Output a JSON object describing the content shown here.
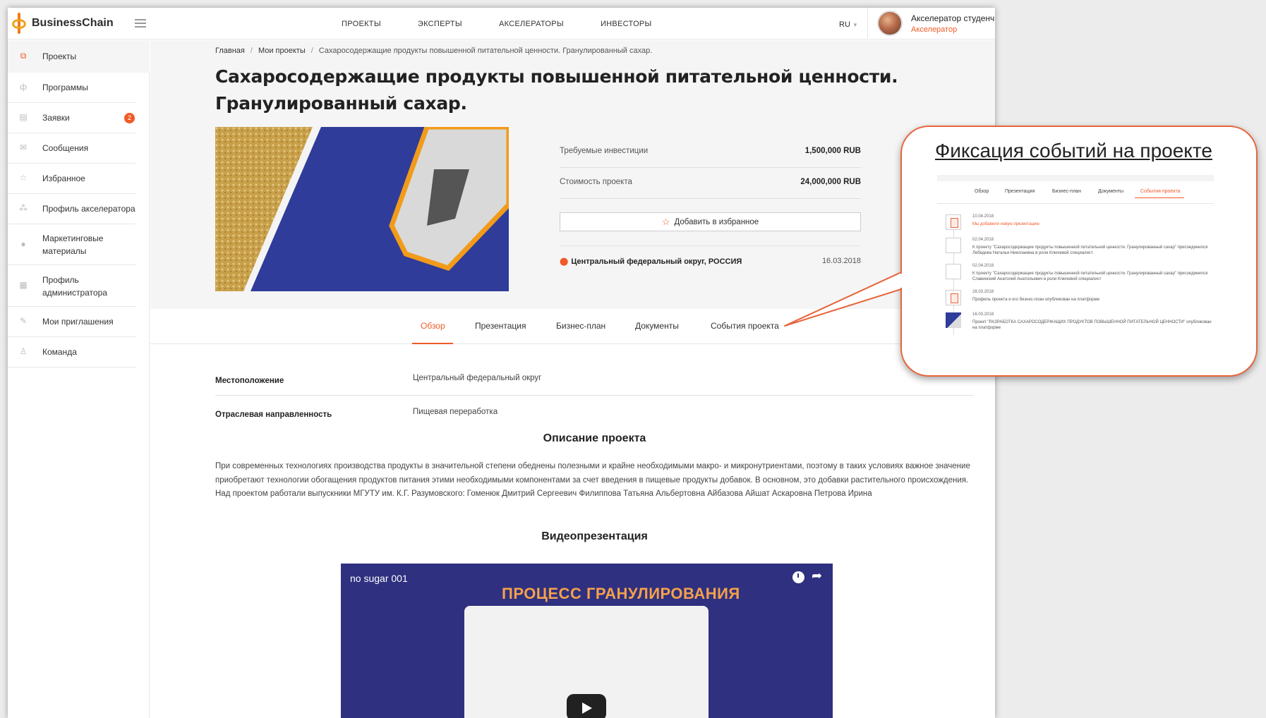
{
  "header": {
    "brand": "BusinessChain",
    "nav": [
      "ПРОЕКТЫ",
      "ЭКСПЕРТЫ",
      "АКСЕЛЕРАТОРЫ",
      "ИНВЕСТОРЫ"
    ],
    "language": "RU",
    "user_name": "Акселератор студенч",
    "user_role": "Акселератор"
  },
  "sidebar": {
    "items": [
      {
        "label": "Проекты",
        "icon": "projects-icon"
      },
      {
        "label": "Программы",
        "icon": "programs-icon"
      },
      {
        "label": "Заявки",
        "icon": "applications-icon",
        "badge": "2"
      },
      {
        "label": "Сообщения",
        "icon": "mail-icon"
      },
      {
        "label": "Избранное",
        "icon": "star-icon"
      },
      {
        "label": "Профиль акселератора",
        "icon": "org-icon"
      },
      {
        "label": "Маркетинговые материалы",
        "icon": "globe-icon"
      },
      {
        "label": "Профиль администратора",
        "icon": "grid-icon"
      },
      {
        "label": "Мои приглашения",
        "icon": "edit-icon"
      },
      {
        "label": "Команда",
        "icon": "user-icon"
      }
    ]
  },
  "breadcrumb": [
    "Главная",
    "Мои проекты",
    "Сахаросодержащие продукты повышенной питательной ценности. Гранулированный сахар."
  ],
  "project": {
    "title": "Сахаросодержащие продукты повышенной питательной ценности. Гранулированный сахар.",
    "investments_label": "Требуемые инвестиции",
    "investments_value": "1,500,000 RUB",
    "cost_label": "Стоимость проекта",
    "cost_value": "24,000,000 RUB",
    "favorite_label": "Добавить в избранное",
    "region": "Центральный федеральный округ, РОССИЯ",
    "date": "16.03.2018"
  },
  "tabs": [
    "Обзор",
    "Презентация",
    "Бизнес-план",
    "Документы",
    "События проекта"
  ],
  "details": {
    "location_label": "Местоположение",
    "location_value": "Центральный федеральный округ",
    "industry_label": "Отраслевая направленность",
    "industry_value": "Пищевая переработка"
  },
  "description": {
    "title": "Описание проекта",
    "text": "При современных технологиях производства продукты в значительной степени обеднены полезными и крайне необходимыми макро- и микронутриентами, поэтому в таких условиях важное значение приобретают технологии обогащения продуктов питания этими необходимыми компонентами за счет введения в пищевые продукты добавок. В основном, это добавки растительного происхождения. Над проектом работали выпускники МГУТУ им. К.Г. Разумовского: Гоменюк Дмитрий Сергеевич Филиппова Татьяна Альбертовна Айбазова Айшат Аскаровна Петрова Ирина"
  },
  "video": {
    "section_title": "Видеопрезентация",
    "title": "no sugar 001",
    "headline": "ПРОЦЕСС ГРАНУЛИРОВАНИЯ"
  },
  "callout": {
    "title": "Фиксация событий на проекте",
    "tabs": [
      "Обзор",
      "Презентация",
      "Бизнес-план",
      "Документы",
      "События проекта"
    ],
    "events": [
      {
        "date": "10.04.2018",
        "text": "Мы добавили новую презентацию"
      },
      {
        "date": "02.04.2018",
        "text": "К проекту \"Сахаросодержащие продукты повышенной питательной ценности. Гранулированный сахар\" присоединился Лебедева Наталья Николаевна в роли Ключевой специалист"
      },
      {
        "date": "02.04.2018",
        "text": "К проекту \"Сахаросодержащие продукты повышенной питательной ценности. Гранулированный сахар\" присоединился Славинский Анатолий Анатольевич в роли Ключевой специалист"
      },
      {
        "date": "28.03.2018",
        "text": "Профиль проекта и его бизнес-план опубликован на платформе"
      },
      {
        "date": "16.03.2018",
        "text": "Проект \"РАЗРАБОТКА САХАРОСОДЕРЖАЩИХ ПРОДУКТОВ ПОВЫШЕННОЙ ПИТАТЕЛЬНОЙ ЦЕННОСТИ\" опубликован на платформе"
      }
    ]
  },
  "colors": {
    "accent": "#f05a28",
    "callout_border": "#e8643a",
    "image_blue": "#2f3c9a"
  }
}
